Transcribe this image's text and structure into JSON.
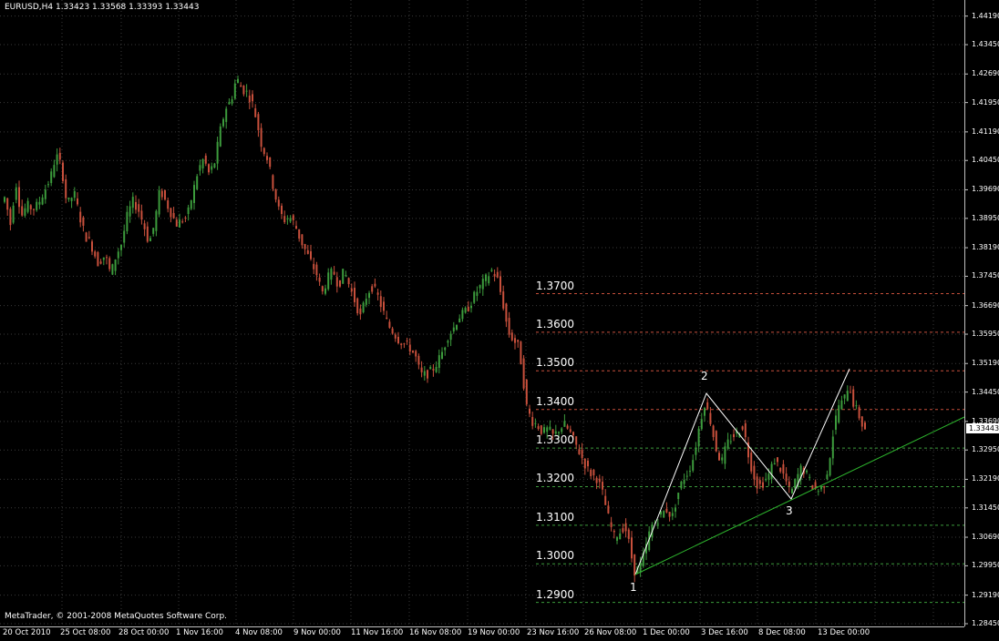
{
  "header": {
    "symbol_line": "EURUSD,H4  1.33423  1.33568  1.33393  1.33443"
  },
  "footer": {
    "copyright": "MetaTrader, © 2001-2008 MetaQuotes Software Corp."
  },
  "current_price": "1.33443",
  "price_levels": [
    {
      "label": "1.3700",
      "value": 1.37,
      "color": "#c8503c"
    },
    {
      "label": "1.3600",
      "value": 1.36,
      "color": "#c8503c"
    },
    {
      "label": "1.3500",
      "value": 1.35,
      "color": "#c8503c"
    },
    {
      "label": "1.3400",
      "value": 1.34,
      "color": "#c8503c"
    },
    {
      "label": "1.3300",
      "value": 1.33,
      "color": "#3c9b3c"
    },
    {
      "label": "1.3200",
      "value": 1.32,
      "color": "#3c9b3c"
    },
    {
      "label": "1.3100",
      "value": 1.31,
      "color": "#3c9b3c"
    },
    {
      "label": "1.3000",
      "value": 1.3,
      "color": "#3c9b3c"
    },
    {
      "label": "1.2900",
      "value": 1.29,
      "color": "#3c9b3c"
    }
  ],
  "wave_labels": [
    "1",
    "2",
    "3"
  ],
  "chart_data": {
    "type": "candlestick",
    "symbol": "EURUSD",
    "timeframe": "H4",
    "ylim": [
      1.2845,
      1.443
    ],
    "y_ticks": [
      "1.44190",
      "1.43450",
      "1.42690",
      "1.41950",
      "1.41190",
      "1.40450",
      "1.39690",
      "1.38950",
      "1.38190",
      "1.37450",
      "1.36690",
      "1.35950",
      "1.35190",
      "1.34450",
      "1.33690",
      "1.32950",
      "1.32190",
      "1.31450",
      "1.30690",
      "1.29950",
      "1.29190",
      "1.28450"
    ],
    "x_ticks": [
      "20 Oct 2010",
      "25 Oct 08:00",
      "28 Oct 00:00",
      "1 Nov 16:00",
      "4 Nov 08:00",
      "9 Nov 00:00",
      "11 Nov 16:00",
      "16 Nov 08:00",
      "19 Nov 00:00",
      "23 Nov 16:00",
      "26 Nov 08:00",
      "1 Dec 00:00",
      "3 Dec 16:00",
      "8 Dec 08:00",
      "13 Dec 00:00"
    ],
    "bull_color": "#3c9b3c",
    "bear_color": "#c8503c",
    "price_path": [
      [
        0,
        1.393
      ],
      [
        6,
        1.395
      ],
      [
        12,
        1.388
      ],
      [
        18,
        1.399
      ],
      [
        24,
        1.39
      ],
      [
        30,
        1.393
      ],
      [
        36,
        1.392
      ],
      [
        42,
        1.393
      ],
      [
        48,
        1.396
      ],
      [
        56,
        1.4
      ],
      [
        62,
        1.406
      ],
      [
        68,
        1.403
      ],
      [
        74,
        1.393
      ],
      [
        82,
        1.396
      ],
      [
        88,
        1.39
      ],
      [
        94,
        1.385
      ],
      [
        100,
        1.383
      ],
      [
        108,
        1.378
      ],
      [
        116,
        1.38
      ],
      [
        122,
        1.375
      ],
      [
        128,
        1.38
      ],
      [
        134,
        1.383
      ],
      [
        140,
        1.39
      ],
      [
        146,
        1.394
      ],
      [
        152,
        1.392
      ],
      [
        158,
        1.388
      ],
      [
        164,
        1.383
      ],
      [
        170,
        1.388
      ],
      [
        176,
        1.397
      ],
      [
        182,
        1.394
      ],
      [
        188,
        1.391
      ],
      [
        194,
        1.388
      ],
      [
        200,
        1.389
      ],
      [
        206,
        1.39
      ],
      [
        212,
        1.396
      ],
      [
        218,
        1.402
      ],
      [
        224,
        1.405
      ],
      [
        230,
        1.401
      ],
      [
        236,
        1.404
      ],
      [
        242,
        1.412
      ],
      [
        248,
        1.418
      ],
      [
        254,
        1.42
      ],
      [
        260,
        1.426
      ],
      [
        266,
        1.423
      ],
      [
        272,
        1.422
      ],
      [
        278,
        1.419
      ],
      [
        282,
        1.415
      ],
      [
        288,
        1.408
      ],
      [
        294,
        1.405
      ],
      [
        300,
        1.398
      ],
      [
        306,
        1.392
      ],
      [
        312,
        1.389
      ],
      [
        318,
        1.39
      ],
      [
        324,
        1.388
      ],
      [
        330,
        1.384
      ],
      [
        336,
        1.381
      ],
      [
        342,
        1.378
      ],
      [
        348,
        1.375
      ],
      [
        354,
        1.37
      ],
      [
        360,
        1.374
      ],
      [
        366,
        1.376
      ],
      [
        372,
        1.372
      ],
      [
        378,
        1.376
      ],
      [
        384,
        1.372
      ],
      [
        390,
        1.368
      ],
      [
        396,
        1.364
      ],
      [
        402,
        1.369
      ],
      [
        408,
        1.372
      ],
      [
        414,
        1.37
      ],
      [
        420,
        1.366
      ],
      [
        426,
        1.362
      ],
      [
        432,
        1.36
      ],
      [
        438,
        1.358
      ],
      [
        444,
        1.357
      ],
      [
        450,
        1.356
      ],
      [
        456,
        1.354
      ],
      [
        462,
        1.349
      ],
      [
        468,
        1.349
      ],
      [
        474,
        1.35
      ],
      [
        480,
        1.352
      ],
      [
        486,
        1.355
      ],
      [
        492,
        1.359
      ],
      [
        498,
        1.361
      ],
      [
        504,
        1.364
      ],
      [
        510,
        1.365
      ],
      [
        516,
        1.367
      ],
      [
        522,
        1.37
      ],
      [
        528,
        1.372
      ],
      [
        534,
        1.374
      ],
      [
        540,
        1.376
      ],
      [
        546,
        1.374
      ],
      [
        552,
        1.368
      ],
      [
        558,
        1.36
      ],
      [
        564,
        1.358
      ],
      [
        570,
        1.356
      ],
      [
        574,
        1.349
      ],
      [
        578,
        1.341
      ],
      [
        584,
        1.337
      ],
      [
        590,
        1.336
      ],
      [
        596,
        1.334
      ],
      [
        602,
        1.335
      ],
      [
        608,
        1.333
      ],
      [
        614,
        1.335
      ],
      [
        620,
        1.336
      ],
      [
        626,
        1.334
      ],
      [
        632,
        1.331
      ],
      [
        638,
        1.328
      ],
      [
        644,
        1.325
      ],
      [
        650,
        1.323
      ],
      [
        656,
        1.322
      ],
      [
        662,
        1.318
      ],
      [
        668,
        1.312
      ],
      [
        674,
        1.307
      ],
      [
        680,
        1.308
      ],
      [
        686,
        1.31
      ],
      [
        692,
        1.304
      ],
      [
        696,
        1.298
      ],
      [
        702,
        1.299
      ],
      [
        708,
        1.303
      ],
      [
        714,
        1.309
      ],
      [
        720,
        1.311
      ],
      [
        726,
        1.313
      ],
      [
        732,
        1.314
      ],
      [
        738,
        1.312
      ],
      [
        744,
        1.318
      ],
      [
        750,
        1.322
      ],
      [
        756,
        1.324
      ],
      [
        762,
        1.328
      ],
      [
        768,
        1.336
      ],
      [
        774,
        1.342
      ],
      [
        780,
        1.337
      ],
      [
        786,
        1.33
      ],
      [
        792,
        1.326
      ],
      [
        798,
        1.331
      ],
      [
        804,
        1.333
      ],
      [
        810,
        1.334
      ],
      [
        816,
        1.336
      ],
      [
        820,
        1.33
      ],
      [
        826,
        1.324
      ],
      [
        832,
        1.32
      ],
      [
        838,
        1.321
      ],
      [
        844,
        1.323
      ],
      [
        850,
        1.327
      ],
      [
        856,
        1.325
      ],
      [
        862,
        1.322
      ],
      [
        868,
        1.318
      ],
      [
        874,
        1.322
      ],
      [
        880,
        1.325
      ],
      [
        886,
        1.323
      ],
      [
        892,
        1.32
      ],
      [
        898,
        1.319
      ],
      [
        904,
        1.32
      ],
      [
        910,
        1.326
      ],
      [
        914,
        1.333
      ],
      [
        920,
        1.341
      ],
      [
        926,
        1.342
      ],
      [
        932,
        1.347
      ],
      [
        936,
        1.342
      ],
      [
        942,
        1.339
      ],
      [
        948,
        1.335
      ]
    ]
  }
}
